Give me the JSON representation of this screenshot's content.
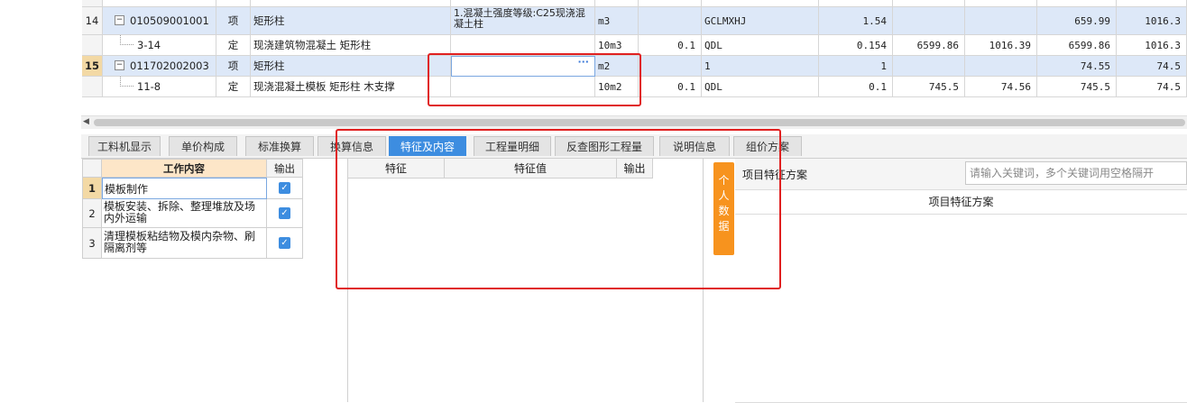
{
  "grid": {
    "rows": [
      {
        "kind": "main",
        "rn": "14",
        "code": "010509001001",
        "type": "项",
        "name": "矩形柱",
        "feature": "1.混凝土强度等级:C25现浇混凝土柱",
        "unit": "m3",
        "qty": "",
        "expr": "GCLMXHJ",
        "c1": "1.54",
        "c2": "",
        "c3": "",
        "c4": "659.99",
        "c5": "1016.3"
      },
      {
        "kind": "sub",
        "rn": "",
        "code": "3-14",
        "type": "定",
        "name": "现浇建筑物混凝土 矩形柱",
        "feature": "",
        "unit": "10m3",
        "qty": "0.1",
        "expr": "QDL",
        "c1": "0.154",
        "c2": "6599.86",
        "c3": "1016.39",
        "c4": "6599.86",
        "c5": "1016.3"
      },
      {
        "kind": "main",
        "rn": "15",
        "code": "011702002003",
        "type": "项",
        "name": "矩形柱",
        "feature": "",
        "unit": "m2",
        "qty": "",
        "expr": "1",
        "c1": "1",
        "c2": "",
        "c3": "",
        "c4": "74.55",
        "c5": "74.5"
      },
      {
        "kind": "sub",
        "rn": "",
        "code": "11-8",
        "type": "定",
        "name": "现浇混凝土模板 矩形柱 木支撑",
        "feature": "",
        "unit": "10m2",
        "qty": "0.1",
        "expr": "QDL",
        "c1": "0.1",
        "c2": "745.5",
        "c3": "74.56",
        "c4": "745.5",
        "c5": "74.5"
      }
    ],
    "expand_symbol": "−",
    "ellipsis": "···"
  },
  "tabs": [
    {
      "label": "工料机显示"
    },
    {
      "label": "单价构成"
    },
    {
      "label": "标准换算"
    },
    {
      "label": "换算信息"
    },
    {
      "label": "特征及内容",
      "active": true
    },
    {
      "label": "工程量明细"
    },
    {
      "label": "反查图形工程量"
    },
    {
      "label": "说明信息"
    },
    {
      "label": "组价方案"
    }
  ],
  "work_table": {
    "header_content": "工作内容",
    "header_output": "输出",
    "rows": [
      {
        "rn": "1",
        "text": "模板制作",
        "checked": true
      },
      {
        "rn": "2",
        "text": "模板安装、拆除、整理堆放及场内外运输",
        "checked": true
      },
      {
        "rn": "3",
        "text": "清理模板粘结物及模内杂物、刷隔离剂等",
        "checked": true
      }
    ],
    "check_glyph": "✓"
  },
  "feature_table": {
    "col_feature": "特征",
    "col_value": "特征值",
    "col_output": "输出"
  },
  "right_panel": {
    "personal_button": "个人数据",
    "scheme_label": "项目特征方案",
    "search_placeholder": "请输入关键词，多个关键词用空格隔开",
    "column_header": "项目特征方案"
  },
  "colors": {
    "active_tab": "#3d8de0",
    "personal_button": "#f7931e",
    "highlight_box": "#e02020"
  }
}
